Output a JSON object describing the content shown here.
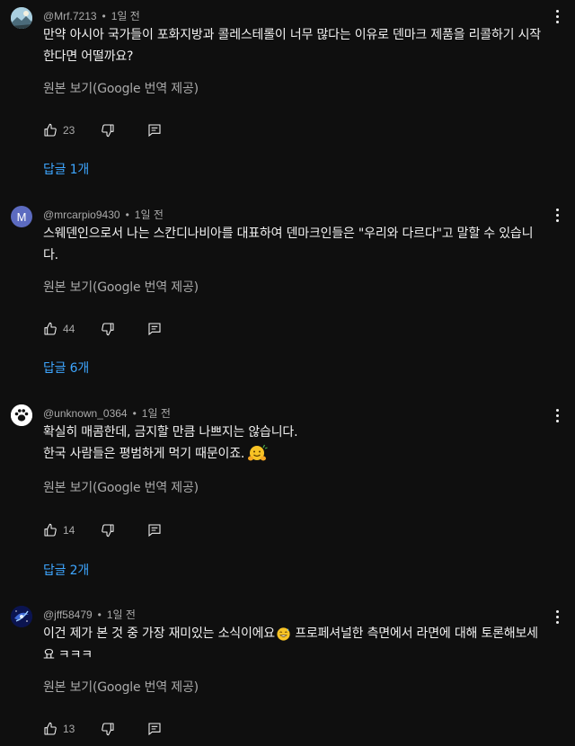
{
  "comments": [
    {
      "author": "@Mrf.7213",
      "time": "1일 전",
      "lines": [
        "만약 아시아 국가들이 포화지방과 콜레스테롤이 너무 많다는 이유로 덴마크 제품을 리콜하기 시작",
        "한다면 어떨까요?"
      ],
      "translate": "원본 보기(Google 번역 제공)",
      "likes": "23",
      "replies": "답글 1개",
      "avatar": "landscape-avatar"
    },
    {
      "author": "@mrcarpio9430",
      "time": "1일 전",
      "lines": [
        "스웨덴인으로서 나는 스칸디나비아를 대표하여 덴마크인들은 \"우리와 다르다\"고 말할 수 있습니",
        "다."
      ],
      "translate": "원본 보기(Google 번역 제공)",
      "likes": "44",
      "replies": "답글 6개",
      "avatar_letter": "M",
      "avatar_color": "#5c6bc0"
    },
    {
      "author": "@unknown_0364",
      "time": "1일 전",
      "lines": [
        "확실히 매콤한데, 금지할 만큼 나쁘지는 않습니다.",
        "한국 사람들은 평범하게 먹기 때문이죠."
      ],
      "translate": "원본 보기(Google 번역 제공)",
      "likes": "14",
      "replies": "답글 2개",
      "avatar": "paw-avatar"
    },
    {
      "author": "@jff58479",
      "time": "1일 전",
      "lines": [
        "이건 제가 본 것 중 가장 재미있는 소식이에요",
        " 프로페셔널한 측면에서 라면에 대해 토론해보세",
        "요 ㅋㅋㅋ"
      ],
      "translate": "원본 보기(Google 번역 제공)",
      "likes": "13",
      "avatar": "galaxy-avatar"
    }
  ]
}
